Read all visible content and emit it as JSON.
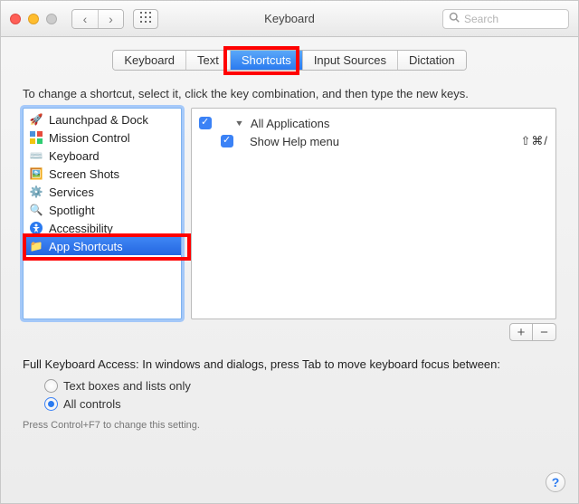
{
  "window": {
    "title": "Keyboard"
  },
  "search": {
    "placeholder": "Search"
  },
  "tabs": {
    "keyboard": "Keyboard",
    "text": "Text",
    "shortcuts": "Shortcuts",
    "input_sources": "Input Sources",
    "dictation": "Dictation"
  },
  "instructions": "To change a shortcut, select it, click the key combination, and then type the new keys.",
  "categories": [
    {
      "label": "Launchpad & Dock",
      "icon": "launchpad-icon"
    },
    {
      "label": "Mission Control",
      "icon": "mission-control-icon"
    },
    {
      "label": "Keyboard",
      "icon": "keyboard-icon"
    },
    {
      "label": "Screen Shots",
      "icon": "screenshots-icon"
    },
    {
      "label": "Services",
      "icon": "services-icon"
    },
    {
      "label": "Spotlight",
      "icon": "spotlight-icon"
    },
    {
      "label": "Accessibility",
      "icon": "accessibility-icon"
    },
    {
      "label": "App Shortcuts",
      "icon": "app-shortcuts-icon"
    }
  ],
  "shortcuts": {
    "group_label": "All Applications",
    "items": [
      {
        "checked": true,
        "label": "Show Help menu",
        "keys": "⇧⌘/"
      }
    ]
  },
  "buttons": {
    "add": "+",
    "remove": "−"
  },
  "fka": {
    "label": "Full Keyboard Access: In windows and dialogs, press Tab to move keyboard focus between:",
    "option_text": "Text boxes and lists only",
    "option_all": "All controls",
    "hint": "Press Control+F7 to change this setting."
  },
  "help": "?"
}
